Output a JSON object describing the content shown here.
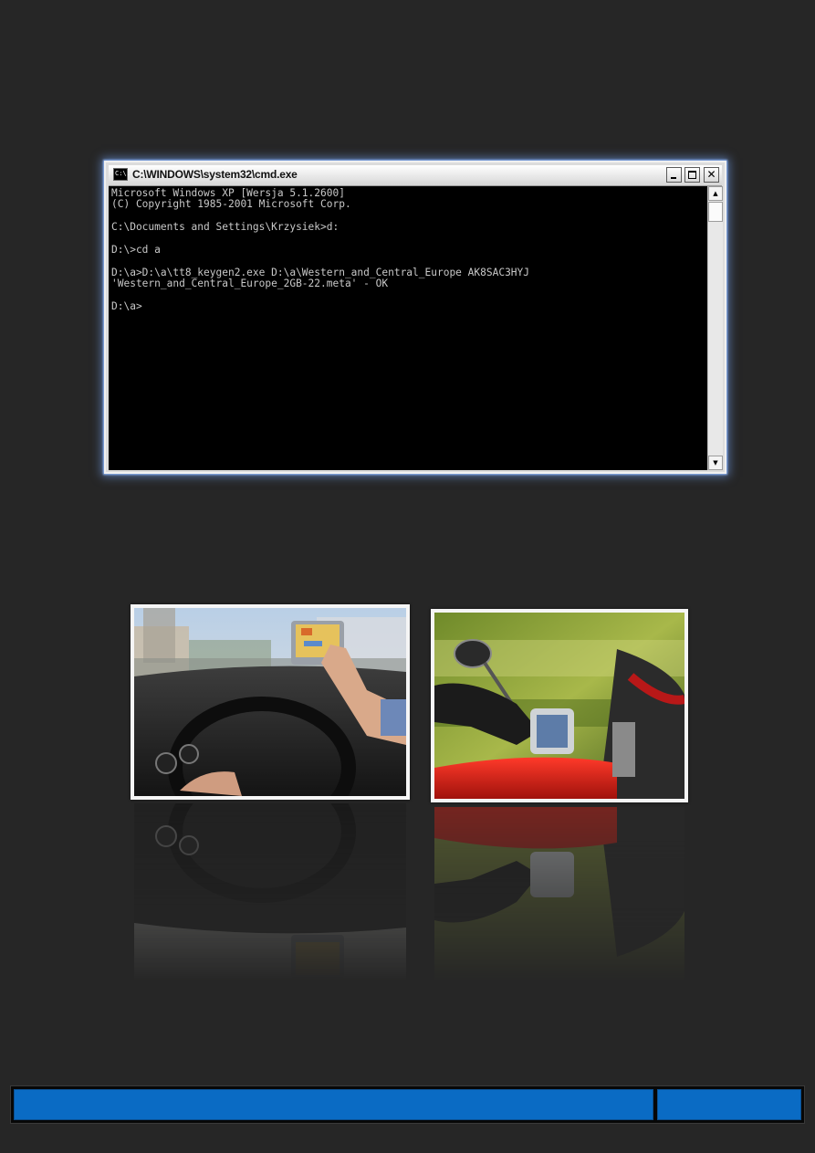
{
  "window": {
    "title": "C:\\WINDOWS\\system32\\cmd.exe",
    "icon": "cmd-icon",
    "icon_text": "C:\\."
  },
  "console": {
    "lines": [
      "Microsoft Windows XP [Wersja 5.1.2600]",
      "(C) Copyright 1985-2001 Microsoft Corp.",
      "",
      "C:\\Documents and Settings\\Krzysiek>d:",
      "",
      "D:\\>cd a",
      "",
      "D:\\a>D:\\a\\tt8_keygen2.exe D:\\a\\Western_and_Central_Europe AK8SAC3HYJ",
      "'Western_and_Central_Europe_2GB-22.meta' - OK",
      "",
      "D:\\a>"
    ]
  },
  "photos": [
    {
      "subject": "car-gps-navigation"
    },
    {
      "subject": "motorcycle-gps-navigation"
    }
  ],
  "footer": {
    "color": "#0a6bc4"
  }
}
